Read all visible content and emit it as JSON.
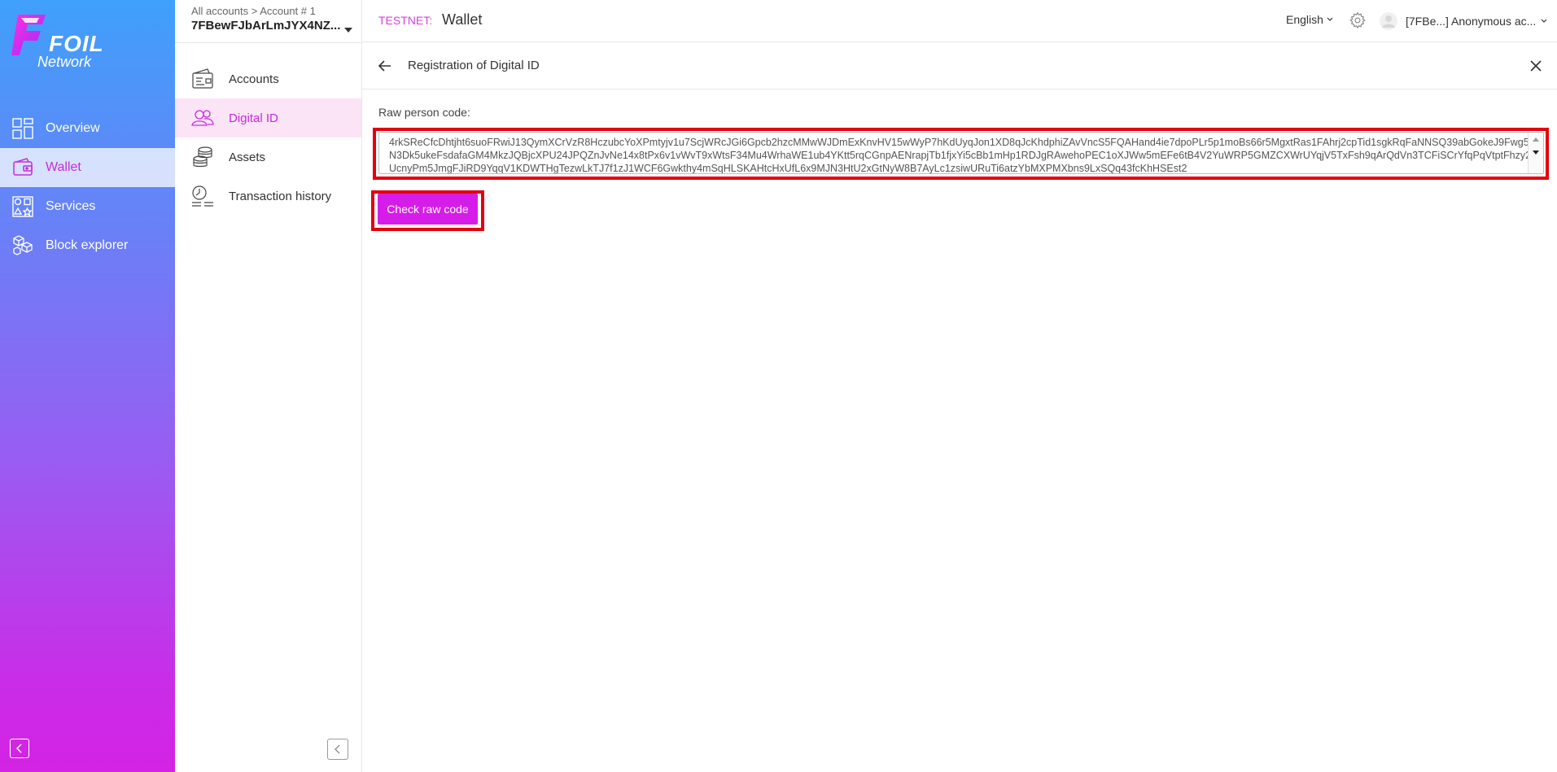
{
  "brand": {
    "logo_main": "FOIL",
    "logo_sub": "Network"
  },
  "nav": {
    "items": [
      {
        "label": "Overview",
        "icon": "grid-icon",
        "active": false
      },
      {
        "label": "Wallet",
        "icon": "wallet-icon",
        "active": true
      },
      {
        "label": "Services",
        "icon": "shapes-icon",
        "active": false
      },
      {
        "label": "Block explorer",
        "icon": "cubes-icon",
        "active": false
      }
    ]
  },
  "account": {
    "breadcrumb": "All accounts > Account # 1",
    "address": "7FBewFJbArLmJYX4NZ..."
  },
  "subnav": {
    "items": [
      {
        "label": "Accounts",
        "icon": "wallet-card-icon",
        "active": false
      },
      {
        "label": "Digital ID",
        "icon": "people-icon",
        "active": true
      },
      {
        "label": "Assets",
        "icon": "coins-icon",
        "active": false
      },
      {
        "label": "Transaction history",
        "icon": "clock-list-icon",
        "active": false
      }
    ]
  },
  "header": {
    "network": "TESTNET:",
    "title": "Wallet",
    "language": "English",
    "user": "[7FBe...] Anonymous ac..."
  },
  "page": {
    "title": "Registration of Digital ID",
    "field_label": "Raw person code:",
    "raw_code": "4rkSReCfcDhtjht6suoFRwiJ13QymXCrVzR8HczubcYoXPmtyjv1u7ScjWRcJGi6Gpcb2hzcMMwWJDmExKnvHV15wWyP7hKdUyqJon1XD8qJcKhdphiZAvVncS5FQAHand4ie7dpoPLr5p1moBs66r5MgxtRas1FAhrj2cpTid1sgkRqFaNNSQ39abGokeJ9Fwg5N3Dk5ukeFsdafaGM4MkzJQBjcXPU24JPQZnJvNe14x8tPx6v1vWvT9xWtsF34Mu4WrhaWE1ub4YKtt5rqCGnpAENrapjTb1fjxYi5cBb1mHp1RDJgRAwehoPEC1oXJWw5mEFe6tB4V2YuWRP5GMZCXWrUYqjV5TxFsh9qArQdVn3TCFiSCrYfqPqVtptFhzy2UcnyPm5JmgFJiRD9YqqV1KDWTHgTezwLkTJ7f1zJ1WCF6Gwkthy4mSqHLSKAHtcHxUfL6x9MJN3HtU2xGtNyW8B7AyLc1zsiwURuTi6atzYbMXPMXbns9LxSQq43fcKhHSEst2",
    "check_button": "Check raw code"
  },
  "colors": {
    "accent": "#d61ce8",
    "highlight": "#e3000f",
    "active_sub_bg": "#fbe4f5"
  }
}
